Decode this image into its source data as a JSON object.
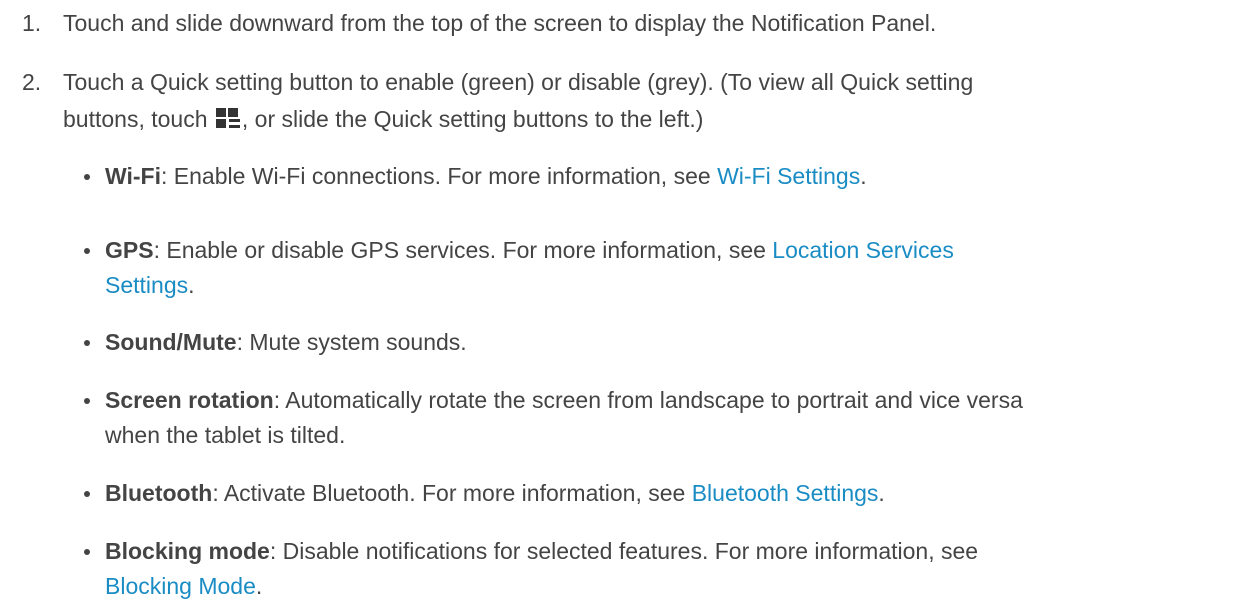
{
  "steps": [
    {
      "number": "1.",
      "text": "Touch and slide downward from the top of the screen to display the Notification Panel."
    },
    {
      "number": "2.",
      "text_line1": "Touch a Quick setting button to enable (green) or disable (grey). (To view all Quick setting",
      "text_before_icon": "buttons, touch",
      "icon": "quick-settings-grid-icon",
      "text_after_icon": ", or slide the Quick setting buttons to the left.)"
    }
  ],
  "bullets": [
    {
      "term": "Wi-Fi",
      "desc": ": Enable Wi-Fi connections. For more information, see ",
      "link": "Wi-Fi Settings",
      "tail": "."
    },
    {
      "term": "GPS",
      "desc": ": Enable or disable GPS services. For more information, see ",
      "link_part1": "Location Services",
      "link_part2": "Settings",
      "tail": "."
    },
    {
      "term": "Sound/Mute",
      "desc": ": Mute system sounds."
    },
    {
      "term": "Screen rotation",
      "desc_line1": ": Automatically rotate the screen from landscape to portrait and vice versa",
      "desc_line2": "when the tablet is tilted."
    },
    {
      "term": "Bluetooth",
      "desc": ": Activate Bluetooth. For more information, see ",
      "link": "Bluetooth Settings",
      "tail": "."
    },
    {
      "term": "Blocking mode",
      "desc": ": Disable notifications for selected features. For more information, see",
      "link": "Blocking Mode",
      "tail": "."
    }
  ]
}
